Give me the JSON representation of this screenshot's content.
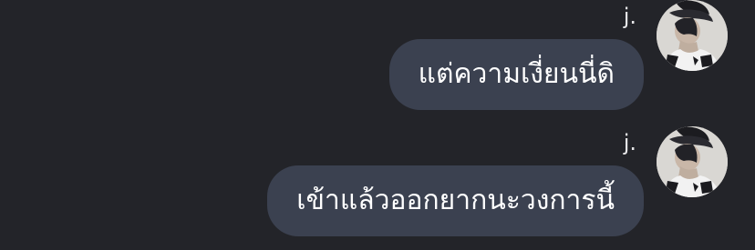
{
  "messages": [
    {
      "sender": "j.",
      "text": "แต่ความเงี่ยนนี่ดิ",
      "avatar_icon": "profile-photo-icon"
    },
    {
      "sender": "j.",
      "text": "เข้าแล้วออกยากนะวงการนี้",
      "avatar_icon": "profile-photo-icon"
    }
  ],
  "colors": {
    "background": "#232429",
    "bubble": "#3b4150",
    "text": "#ffffff",
    "sender": "#e6e6e8"
  }
}
